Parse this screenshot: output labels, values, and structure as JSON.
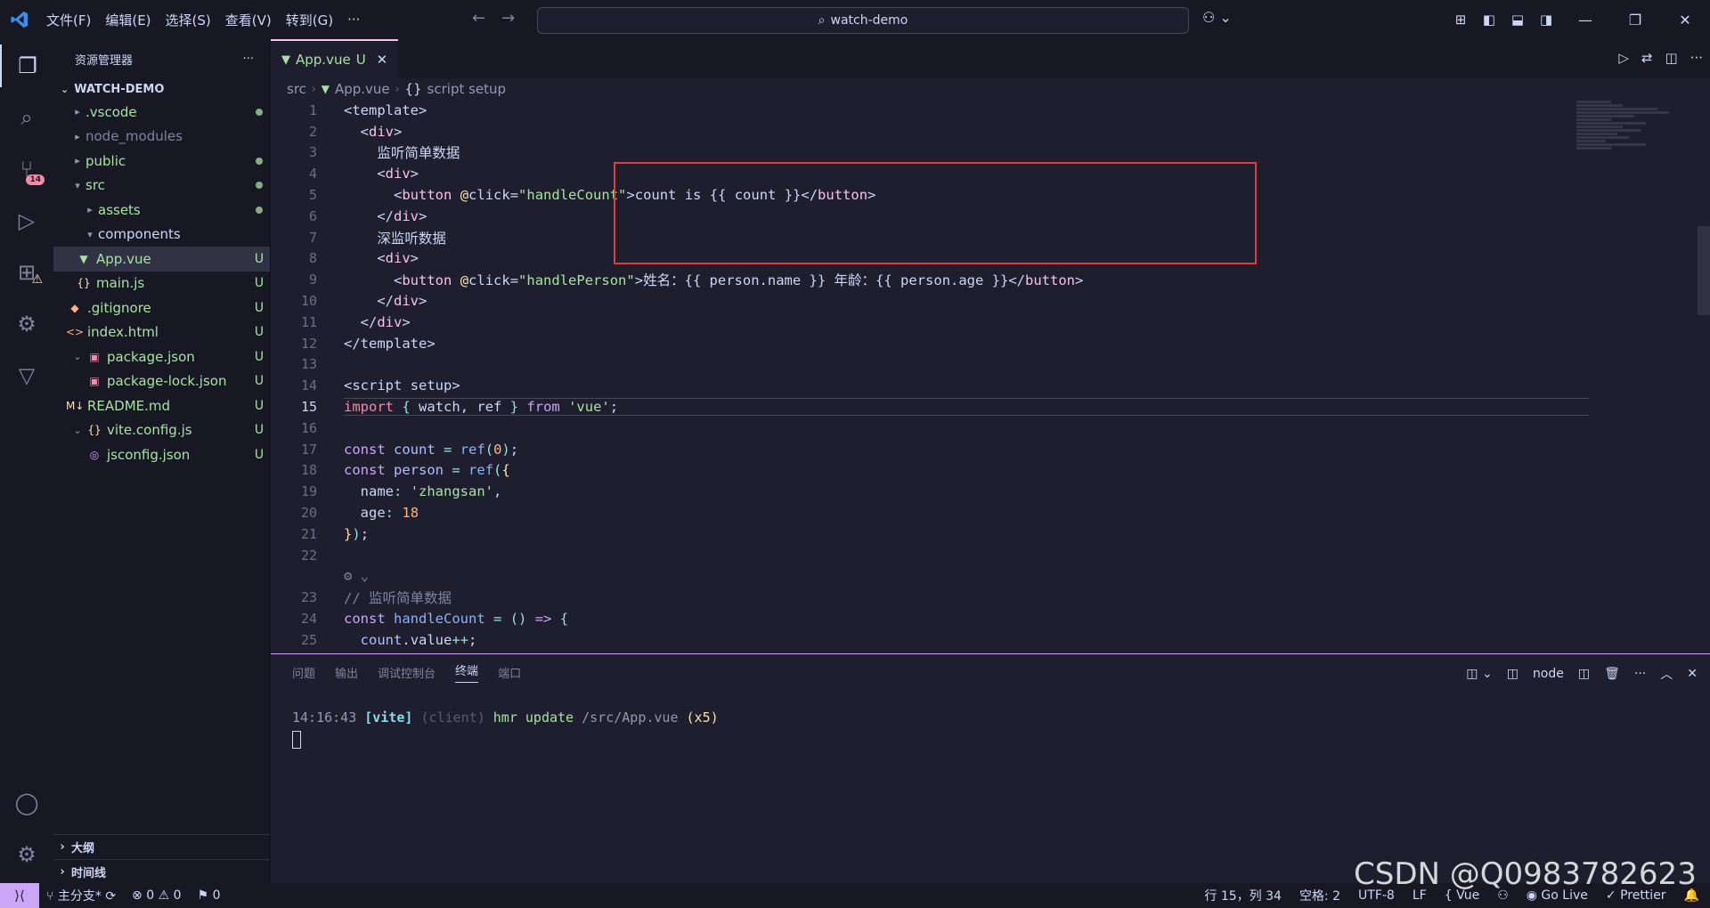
{
  "titlebar": {
    "menu": [
      "文件(F)",
      "编辑(E)",
      "选择(S)",
      "查看(V)",
      "转到(G)",
      "···"
    ],
    "search": "watch-demo"
  },
  "activity": {
    "scm_badge": "14"
  },
  "explorer": {
    "title": "资源管理器",
    "more": "···",
    "project": "WATCH-DEMO",
    "items": [
      {
        "name": ".vscode",
        "status": "dot"
      },
      {
        "name": "node_modules",
        "status": ""
      },
      {
        "name": "public",
        "status": "dot"
      },
      {
        "name": "src",
        "status": "dot"
      },
      {
        "name": "assets",
        "status": "dot"
      },
      {
        "name": "components",
        "status": ""
      },
      {
        "name": "App.vue",
        "status": "U"
      },
      {
        "name": "main.js",
        "status": "U"
      },
      {
        "name": ".gitignore",
        "status": "U"
      },
      {
        "name": "index.html",
        "status": "U"
      },
      {
        "name": "package.json",
        "status": "U"
      },
      {
        "name": "package-lock.json",
        "status": "U"
      },
      {
        "name": "README.md",
        "status": "U"
      },
      {
        "name": "vite.config.js",
        "status": "U"
      },
      {
        "name": "jsconfig.json",
        "status": "U"
      }
    ],
    "outline": "大纲",
    "timeline": "时间线"
  },
  "editor": {
    "tab_name": "App.vue",
    "tab_status": "U",
    "breadcrumb": [
      "src",
      "App.vue",
      "script setup"
    ],
    "current_line": 15,
    "code_lines": [
      {
        "n": "1"
      },
      {
        "n": "2"
      },
      {
        "n": "3"
      },
      {
        "n": "4"
      },
      {
        "n": "5"
      },
      {
        "n": "6"
      },
      {
        "n": "7"
      },
      {
        "n": "8"
      },
      {
        "n": "9"
      },
      {
        "n": "10"
      },
      {
        "n": "11"
      },
      {
        "n": "12"
      },
      {
        "n": "13"
      },
      {
        "n": "14"
      },
      {
        "n": "15"
      },
      {
        "n": "16"
      },
      {
        "n": "17"
      },
      {
        "n": "18"
      },
      {
        "n": "19"
      },
      {
        "n": "20"
      },
      {
        "n": "21"
      },
      {
        "n": "22"
      },
      {
        "n": ""
      },
      {
        "n": "23"
      },
      {
        "n": "24"
      },
      {
        "n": "25"
      }
    ],
    "code_text": {
      "l3": "监听简单数据",
      "l5_handler": "handleCount",
      "l5_text": "count is {{ count }}",
      "l7": "深监听数据",
      "l9_handler": "handlePerson",
      "l9_text": "姓名：{{ person.name }} 年龄：{{ person.age }}",
      "l15_from": "'vue'",
      "l19_val": "'zhangsan'",
      "l20_val": "18",
      "l17_val": "0",
      "l23": "// 监听简单数据"
    }
  },
  "panel": {
    "tabs": [
      "问题",
      "输出",
      "调试控制台",
      "终端",
      "端口"
    ],
    "active_tab": "终端",
    "terminal_name": "node",
    "log": {
      "time": "14:16:43",
      "tag": "[vite]",
      "client": "(client)",
      "msg": "hmr update",
      "path": "/src/App.vue",
      "count": "(x5)"
    }
  },
  "statusbar": {
    "branch": "主分支*",
    "errors": "0",
    "warnings": "0",
    "ports": "0",
    "position": "行 15，列 34",
    "spaces": "空格: 2",
    "encoding": "UTF-8",
    "eol": "LF",
    "language": "Vue",
    "golive": "Go Live",
    "prettier": "Prettier"
  },
  "watermark": "CSDN @Q0983782623",
  "colors": {
    "accent": "#cba6f7",
    "git_untracked": "#a6e3a1",
    "highlight_box": "#e03c3c"
  }
}
